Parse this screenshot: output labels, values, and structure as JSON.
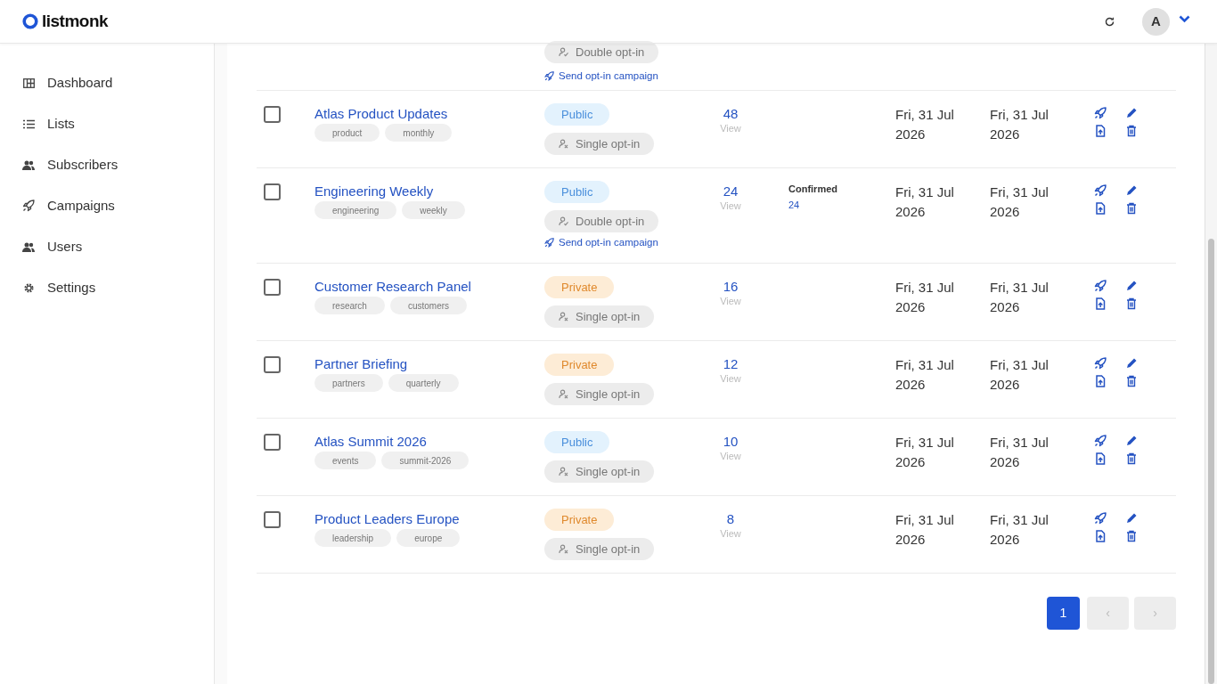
{
  "header": {
    "logo": "listmonk",
    "avatar": "A"
  },
  "sidebar": {
    "items": [
      {
        "label": "Dashboard"
      },
      {
        "label": "Lists"
      },
      {
        "label": "Subscribers"
      },
      {
        "label": "Campaigns"
      },
      {
        "label": "Users"
      },
      {
        "label": "Settings"
      }
    ]
  },
  "partial_row": {
    "optin": {
      "kind": "double",
      "label": "Double opt-in"
    },
    "send_link": "Send opt-in campaign"
  },
  "rows": [
    {
      "checked": false,
      "name": "Atlas Product Updates",
      "tags": [
        "product",
        "monthly"
      ],
      "visibility": {
        "kind": "public",
        "label": "Public"
      },
      "optin": {
        "kind": "single",
        "label": "Single opt-in"
      },
      "count": "48",
      "view": "View",
      "created": "Fri, 31 Jul 2026",
      "updated": "Fri, 31 Jul 2026"
    },
    {
      "checked": false,
      "name": "Engineering Weekly",
      "tags": [
        "engineering",
        "weekly"
      ],
      "visibility": {
        "kind": "public",
        "label": "Public"
      },
      "optin": {
        "kind": "double",
        "label": "Double opt-in"
      },
      "send_link": "Send opt-in campaign",
      "count": "24",
      "view": "View",
      "status": {
        "label": "Confirmed",
        "count": "24"
      },
      "created": "Fri, 31 Jul 2026",
      "updated": "Fri, 31 Jul 2026"
    },
    {
      "checked": false,
      "name": "Customer Research Panel",
      "tags": [
        "research",
        "customers"
      ],
      "visibility": {
        "kind": "private",
        "label": "Private"
      },
      "optin": {
        "kind": "single",
        "label": "Single opt-in"
      },
      "count": "16",
      "view": "View",
      "created": "Fri, 31 Jul 2026",
      "updated": "Fri, 31 Jul 2026"
    },
    {
      "checked": false,
      "name": "Partner Briefing",
      "tags": [
        "partners",
        "quarterly"
      ],
      "visibility": {
        "kind": "private",
        "label": "Private"
      },
      "optin": {
        "kind": "single",
        "label": "Single opt-in"
      },
      "count": "12",
      "view": "View",
      "created": "Fri, 31 Jul 2026",
      "updated": "Fri, 31 Jul 2026"
    },
    {
      "checked": false,
      "name": "Atlas Summit 2026",
      "tags": [
        "events",
        "summit-2026"
      ],
      "visibility": {
        "kind": "public",
        "label": "Public"
      },
      "optin": {
        "kind": "single",
        "label": "Single opt-in"
      },
      "count": "10",
      "view": "View",
      "created": "Fri, 31 Jul 2026",
      "updated": "Fri, 31 Jul 2026"
    },
    {
      "checked": false,
      "name": "Product Leaders Europe",
      "tags": [
        "leadership",
        "europe"
      ],
      "visibility": {
        "kind": "private",
        "label": "Private"
      },
      "optin": {
        "kind": "single",
        "label": "Single opt-in"
      },
      "count": "8",
      "view": "View",
      "created": "Fri, 31 Jul 2026",
      "updated": "Fri, 31 Jul 2026"
    }
  ],
  "pagination": {
    "pages": [
      {
        "label": "1",
        "selected": true
      }
    ],
    "prev": "‹",
    "next": "›"
  }
}
